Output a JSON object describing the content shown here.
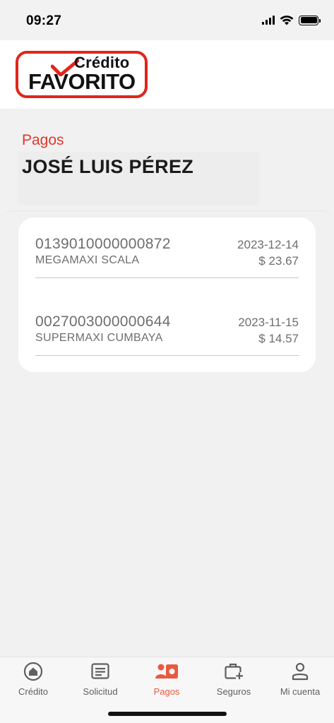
{
  "status_bar": {
    "time": "09:27"
  },
  "brand": {
    "line1": "Crédito",
    "line2": "FAVORITO",
    "color": "#e1251b"
  },
  "page": {
    "section_label": "Pagos",
    "user_name": "JOSÉ LUIS PÉREZ"
  },
  "payments": [
    {
      "code": "0139010000000872",
      "store": "MEGAMAXI SCALA",
      "date": "2023-12-14",
      "amount": "$ 23.67"
    },
    {
      "code": "0027003000000644",
      "store": "SUPERMAXI CUMBAYA",
      "date": "2023-11-15",
      "amount": "$ 14.57"
    }
  ],
  "nav": {
    "active_color": "#e85a3f",
    "items": [
      {
        "label": "Crédito",
        "icon": "home-icon"
      },
      {
        "label": "Solicitud",
        "icon": "form-icon"
      },
      {
        "label": "Pagos",
        "icon": "payments-icon"
      },
      {
        "label": "Seguros",
        "icon": "briefcase-plus-icon"
      },
      {
        "label": "Mi cuenta",
        "icon": "user-icon"
      }
    ],
    "active_index": 2
  }
}
